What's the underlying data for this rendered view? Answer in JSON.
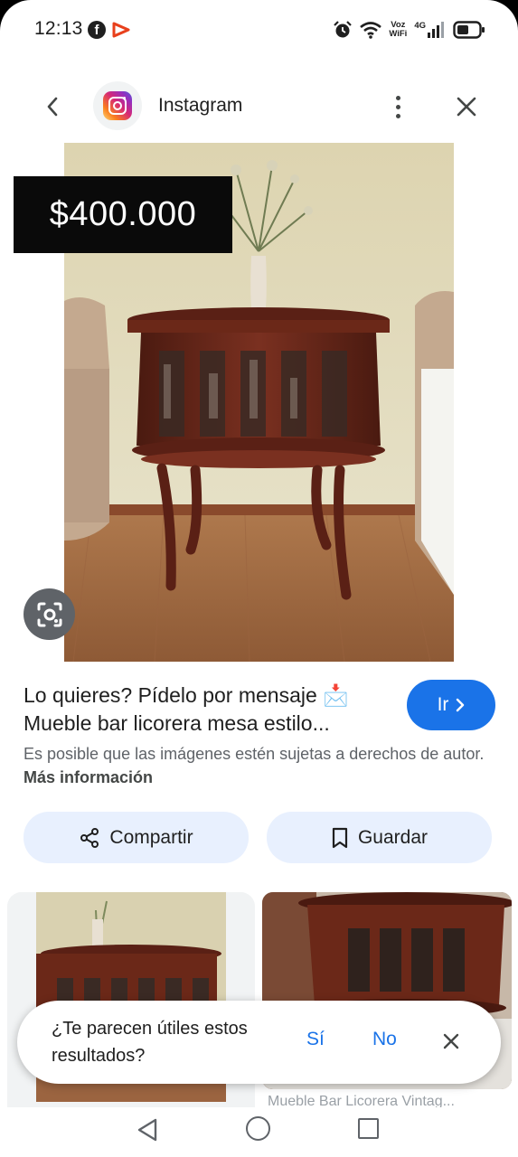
{
  "status_bar": {
    "time": "12:13",
    "network_top": "Voz",
    "network_bottom": "WiFi",
    "lte": "4G"
  },
  "header": {
    "site_name": "Instagram"
  },
  "image": {
    "price": "$400.000"
  },
  "result": {
    "title_line1": "Lo quieres? Pídelo por mensaje 📩",
    "title_line2": "Mueble bar licorera mesa estilo...",
    "go_label": "Ir",
    "copyright_text": "Es posible que las imágenes estén sujetas a derechos de autor.",
    "more_info": "Más información"
  },
  "actions": {
    "share_label": "Compartir",
    "save_label": "Guardar"
  },
  "related": {
    "caption_2": "Mueble Bar Licorera Vintag..."
  },
  "feedback": {
    "question": "¿Te parecen útiles estos resultados?",
    "yes_label": "Sí",
    "no_label": "No"
  },
  "colors": {
    "accent": "#1a73e8",
    "chip_bg": "#e8f0fe",
    "text": "#1f1f1f",
    "muted": "#5f6368"
  }
}
